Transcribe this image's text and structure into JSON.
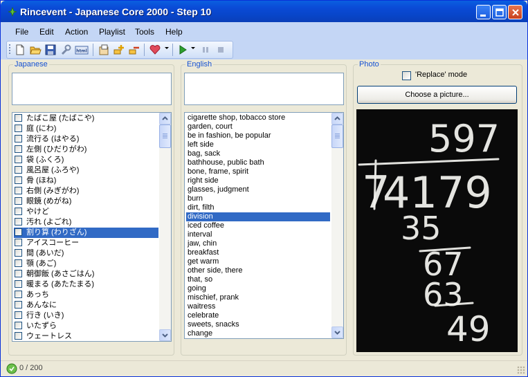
{
  "window": {
    "title": "Rincevent - Japanese Core 2000 - Step 10"
  },
  "menu": [
    "File",
    "Edit",
    "Action",
    "Playlist",
    "Tools",
    "Help"
  ],
  "toolbar": {
    "icons": [
      "new-file-icon",
      "open-folder-icon",
      "save-icon",
      "wrench-icon",
      "html-export-icon",
      "import-icon",
      "add-item-icon",
      "remove-item-icon",
      "heart-icon",
      "play-icon",
      "pause-icon",
      "stop-icon"
    ]
  },
  "japanese": {
    "label": "Japanese",
    "input": "",
    "items": [
      "たばこ屋 (たばこや)",
      "庭 (にわ)",
      "流行る (はやる)",
      "左側 (ひだりがわ)",
      "袋 (ふくろ)",
      "風呂屋 (ふろや)",
      "骨 (ほね)",
      "右側 (みぎがわ)",
      "眼鏡 (めがね)",
      "やけど",
      "汚れ (よごれ)",
      "割り算 (わりざん)",
      "アイスコーヒー",
      "間 (あいだ)",
      "顎 (あご)",
      "朝御飯 (あさごはん)",
      "暖まる (あたたまる)",
      "あっち",
      "あんなに",
      "行き (いき)",
      "いたずら",
      "ウェートレス"
    ],
    "selected_index": 11
  },
  "english": {
    "label": "English",
    "input": "",
    "items": [
      "cigarette shop, tobacco store",
      "garden, court",
      "be in fashion, be popular",
      "left side",
      "bag, sack",
      "bathhouse, public bath",
      "bone, frame, spirit",
      "right side",
      "glasses, judgment",
      "burn",
      "dirt, filth",
      "division",
      "iced coffee",
      "interval",
      "jaw, chin",
      "breakfast",
      "get warm",
      "other side, there",
      "that, so",
      "going",
      "mischief, prank",
      "waitress",
      "celebrate",
      "sweets, snacks",
      "change"
    ],
    "selected_index": 11
  },
  "photo": {
    "label": "Photo",
    "replace_mode_label": "'Replace' mode",
    "replace_mode_checked": false,
    "choose_button": "Choose a picture...",
    "chalkboard": {
      "quotient": "597",
      "divisor": "7",
      "dividend": "4179",
      "step1": "35",
      "step2": "67",
      "step3": "63",
      "remainder": "49"
    }
  },
  "status": {
    "progress_text": "0 / 200",
    "progress": 0
  },
  "colors": {
    "selection": "#316ac5",
    "title_bar": "#0a4ad6",
    "menu_bar": "#c4d6f5",
    "group_label": "#1450d2"
  }
}
